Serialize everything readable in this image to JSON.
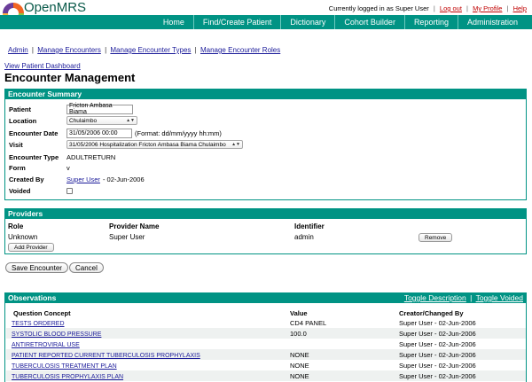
{
  "header": {
    "brand": "OpenMRS",
    "user_text": "Currently logged in as Super User",
    "logout": "Log out",
    "my_profile": "My Profile",
    "help": "Help",
    "nav": [
      "Home",
      "Find/Create Patient",
      "Dictionary",
      "Cohort Builder",
      "Reporting",
      "Administration"
    ]
  },
  "submenu": [
    "Admin",
    "Manage Encounters",
    "Manage Encounter Types",
    "Manage Encounter Roles"
  ],
  "dashboard_link": "View Patient Dashboard",
  "page_title": "Encounter Management",
  "summary": {
    "title": "Encounter Summary",
    "patient_label": "Patient",
    "patient_value": "Fricton Ambasa Biama",
    "location_label": "Location",
    "location_value": "Chulaimbo",
    "date_label": "Encounter Date",
    "date_value": "31/05/2006 00:00",
    "date_format": "(Format: dd/mm/yyyy hh:mm)",
    "visit_label": "Visit",
    "visit_value": "31/05/2006 Hospitalization Fricton Ambasa Biama Chulaimbo",
    "type_label": "Encounter Type",
    "type_value": "ADULTRETURN",
    "form_label": "Form",
    "form_value": "v",
    "created_label": "Created By",
    "created_user": "Super User",
    "created_date": "- 02-Jun-2006",
    "voided_label": "Voided"
  },
  "providers": {
    "title": "Providers",
    "col_role": "Role",
    "col_name": "Provider Name",
    "col_identifier": "Identifier",
    "row": {
      "role": "Unknown",
      "name": "Super User",
      "identifier": "admin"
    },
    "remove": "Remove",
    "add": "Add Provider"
  },
  "actions": {
    "save": "Save Encounter",
    "cancel": "Cancel"
  },
  "observations": {
    "title": "Observations",
    "toggle_description": "Toggle Description",
    "toggle_voided": "Toggle Voided",
    "col_concept": "Question Concept",
    "col_value": "Value",
    "col_creator": "Creator/Changed By",
    "rows": [
      {
        "concept": "TESTS ORDERED",
        "value": "CD4 PANEL",
        "creator": "Super User - 02-Jun-2006"
      },
      {
        "concept": "SYSTOLIC BLOOD PRESSURE",
        "value": "100.0",
        "creator": "Super User - 02-Jun-2006"
      },
      {
        "concept": "ANTIRETROVIRAL USE",
        "value": "",
        "creator": "Super User - 02-Jun-2006"
      },
      {
        "concept": "PATIENT REPORTED CURRENT TUBERCULOSIS PROPHYLAXIS",
        "value": "NONE",
        "creator": "Super User - 02-Jun-2006"
      },
      {
        "concept": "TUBERCULOSIS TREATMENT PLAN",
        "value": "NONE",
        "creator": "Super User - 02-Jun-2006"
      },
      {
        "concept": "TUBERCULOSIS PROPHYLAXIS PLAN",
        "value": "NONE",
        "creator": "Super User - 02-Jun-2006"
      }
    ]
  },
  "colors": {
    "accent": "#009384",
    "link": "#1a1a99",
    "header_link": "#c00000"
  }
}
